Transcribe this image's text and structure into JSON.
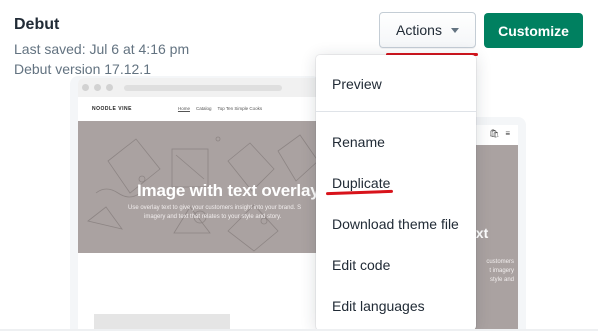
{
  "theme": {
    "name": "Debut",
    "last_saved": "Last saved: Jul 6 at 4:16 pm",
    "version": "Debut version 17.12.1"
  },
  "buttons": {
    "actions": "Actions",
    "customize": "Customize"
  },
  "colors": {
    "primary": "#008060",
    "annotation_red": "#d8131b",
    "hero_gray": "#aaa2a1"
  },
  "menu": {
    "items": [
      "Preview",
      "Rename",
      "Duplicate",
      "Download theme file",
      "Edit code",
      "Edit languages"
    ]
  },
  "preview": {
    "store_name": "NOODLE VINE",
    "nav": [
      "Home",
      "Catalog",
      "Top Ten Simple Cooks"
    ],
    "hero_title": "Image with text overlay",
    "hero_text_line1": "Use overlay text to give your customers insight into your brand. S",
    "hero_text_line2": "imagery and text that relates to your style and story.",
    "mobile_title": "ext",
    "mobile_text": [
      "customers",
      "t imagery",
      "style and"
    ],
    "mobile_icons": [
      "bag-icon",
      "menu-icon"
    ]
  }
}
